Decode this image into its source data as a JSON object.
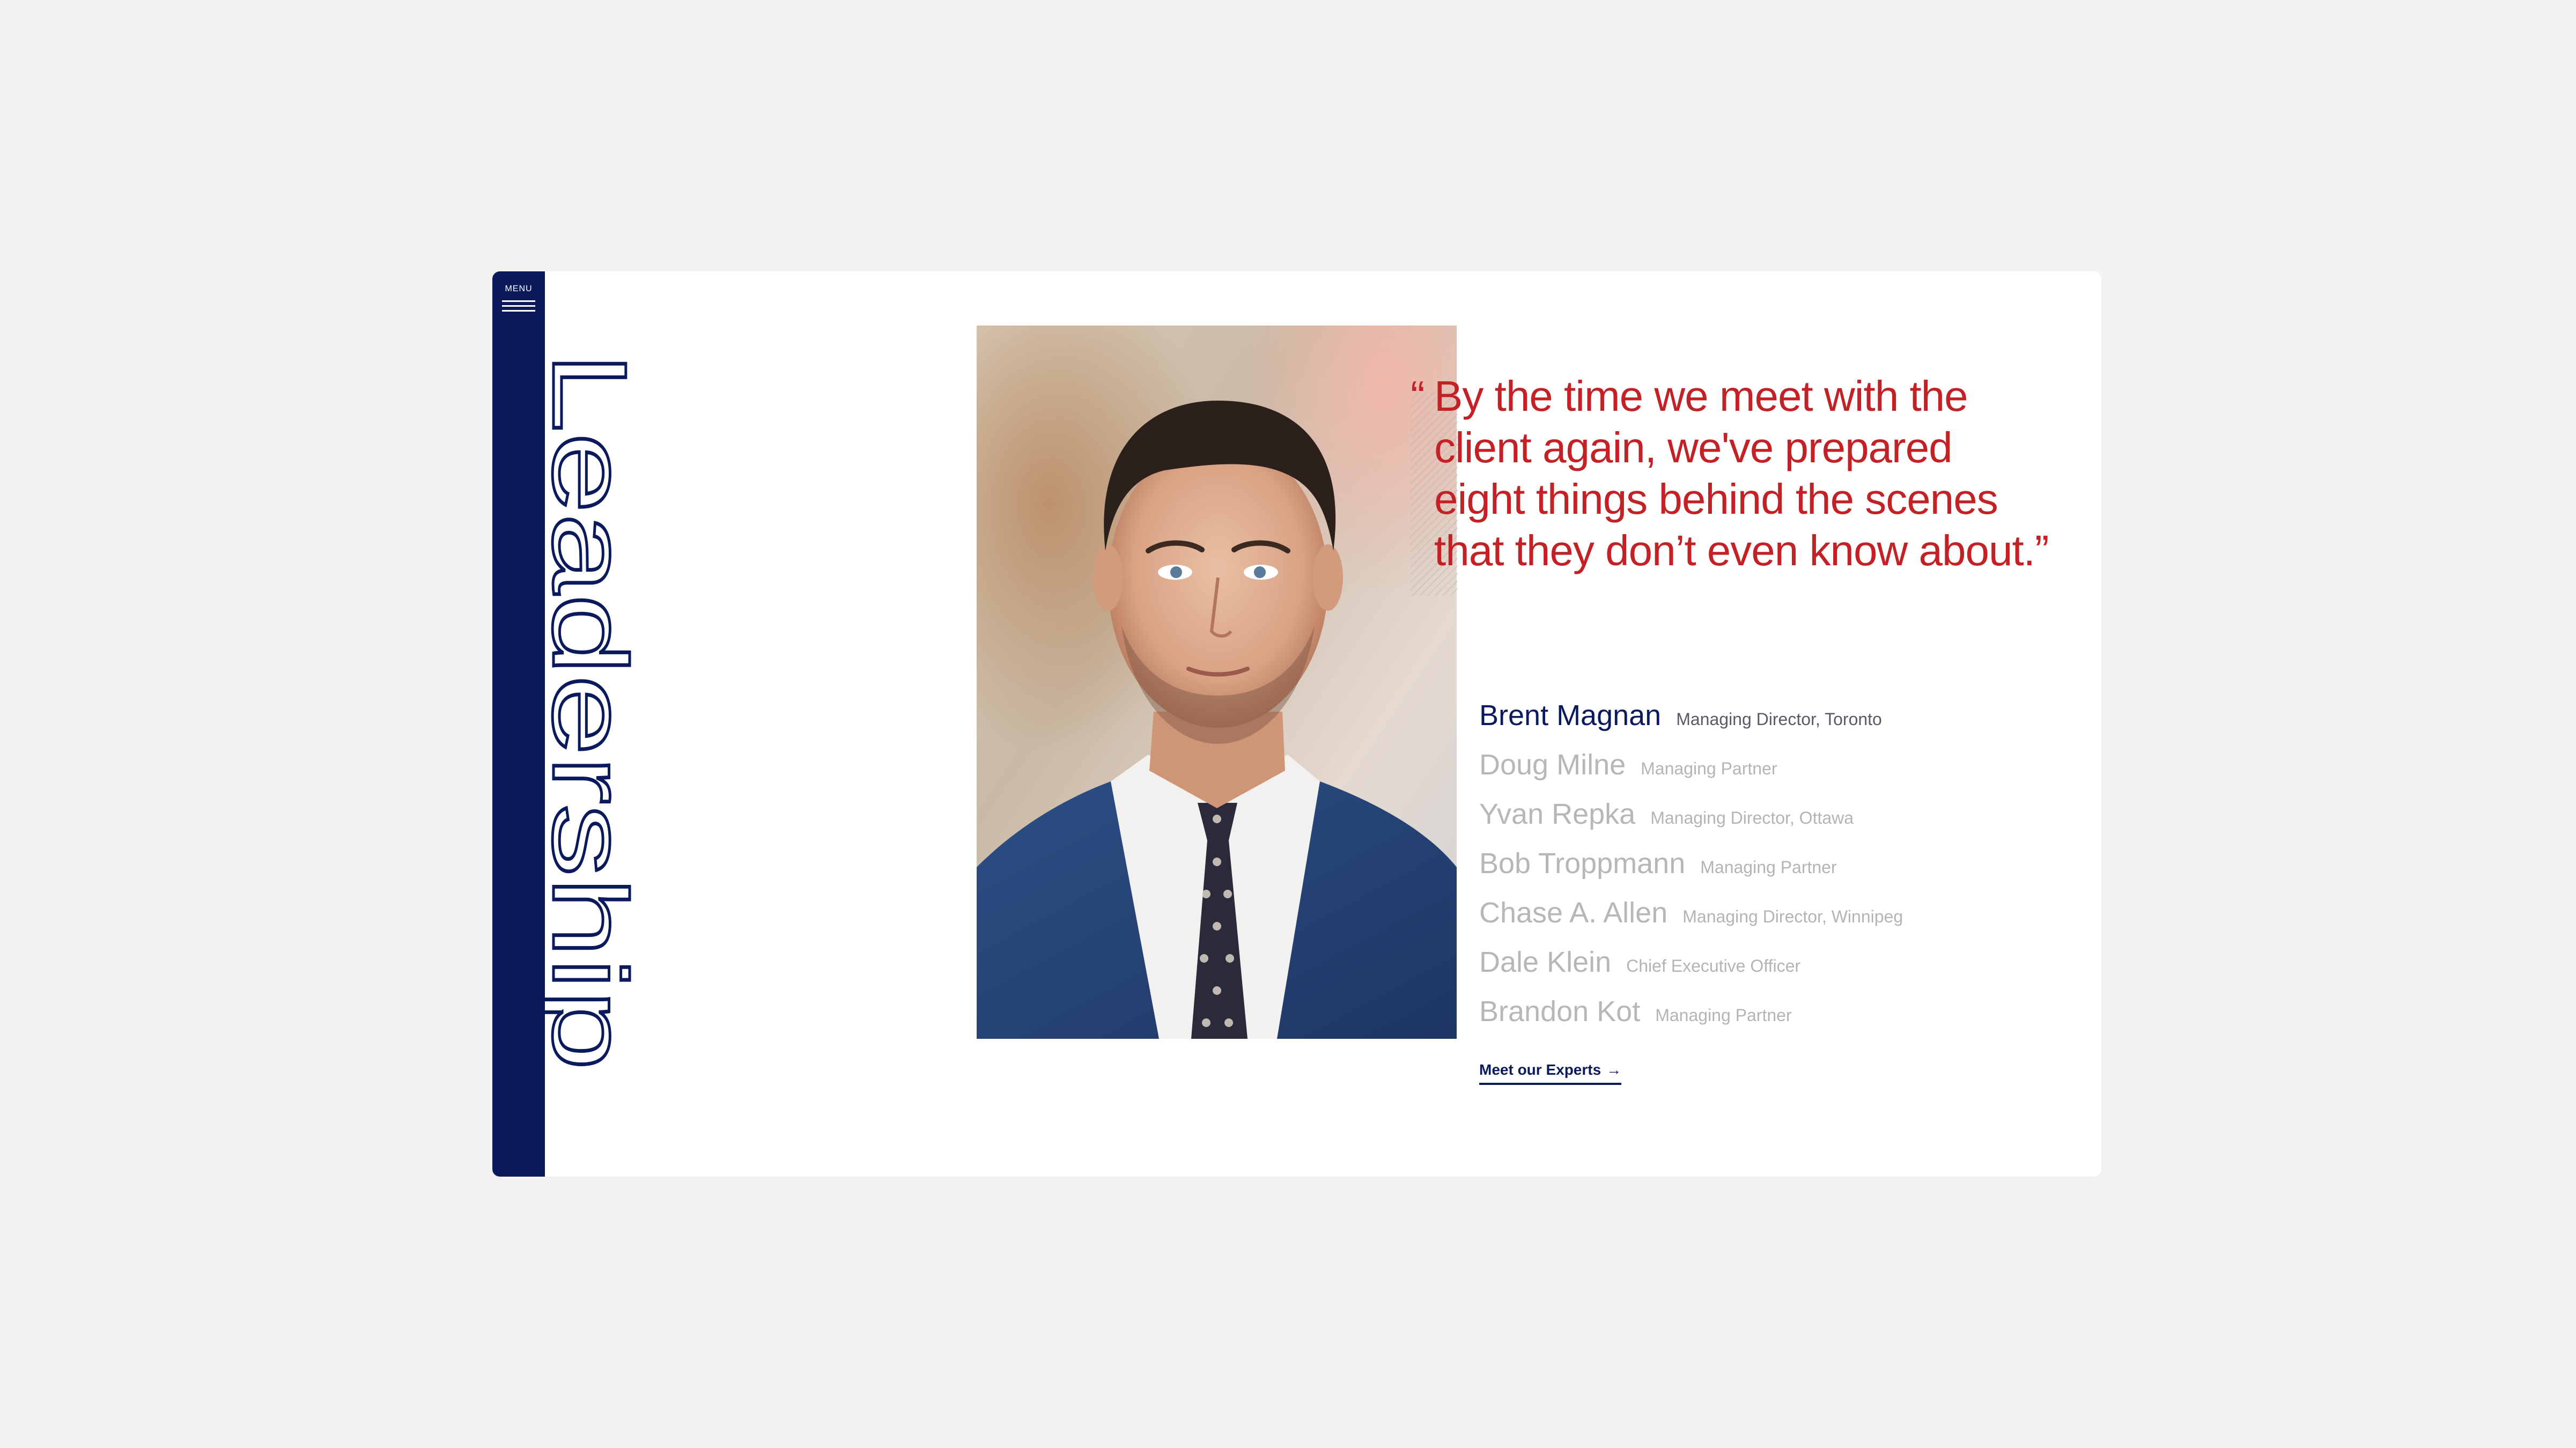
{
  "sidebar": {
    "menu_label": "MENU",
    "menu_icon": "hamburger-icon",
    "color": "#0b1a5c"
  },
  "section": {
    "title": "Leadership"
  },
  "quote": {
    "open_mark": "“",
    "text": "By the time we meet with the client again, we've prepared eight things behind the scenes that they don’t even know about.”",
    "lines": [
      "By the time we meet with the",
      "client again, we've prepared",
      "eight things behind the scenes",
      "that they don’t even know about.”"
    ],
    "color": "#c42126"
  },
  "leaders": [
    {
      "name": "Brent Magnan",
      "role": "Managing Director, Toronto",
      "active": true
    },
    {
      "name": "Doug Milne",
      "role": "Managing Partner",
      "active": false
    },
    {
      "name": "Yvan Repka",
      "role": "Managing Director, Ottawa",
      "active": false
    },
    {
      "name": "Bob Troppmann",
      "role": "Managing Partner",
      "active": false
    },
    {
      "name": "Chase A. Allen",
      "role": "Managing Director, Winnipeg",
      "active": false
    },
    {
      "name": "Dale Klein",
      "role": "Chief Executive Officer",
      "active": false
    },
    {
      "name": "Brandon Kot",
      "role": "Managing Partner",
      "active": false
    }
  ],
  "cta": {
    "label": "Meet our Experts",
    "arrow": "→"
  },
  "photo": {
    "alt": "Brent Magnan portrait"
  }
}
